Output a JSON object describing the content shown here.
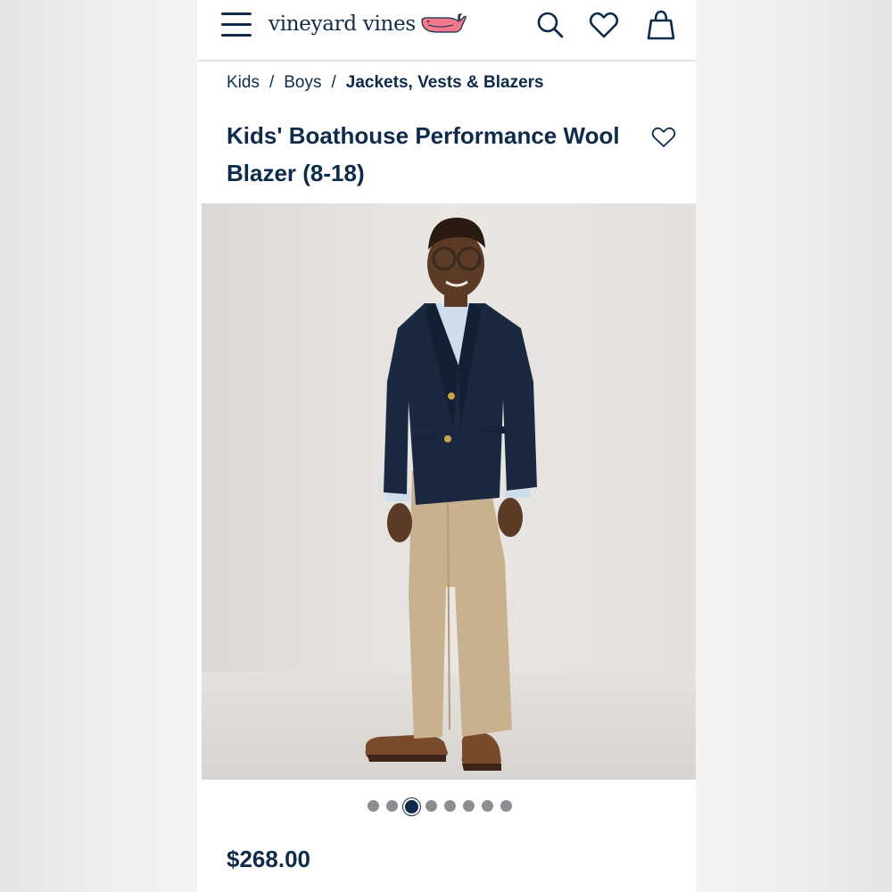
{
  "header": {
    "brand": "vineyard vines",
    "icons": [
      "hamburger-menu-icon",
      "whale-logo-icon",
      "search-icon",
      "heart-icon",
      "shopping-bag-icon"
    ]
  },
  "breadcrumb": {
    "items": [
      "Kids",
      "Boys",
      "Jackets, Vests & Blazers"
    ],
    "separator": "/"
  },
  "product": {
    "title": "Kids' Boathouse Performance Wool Blazer (8-18)",
    "price": "$268.00",
    "image_alt": "Boy wearing navy blazer, light blue shirt, khaki pants and brown boat shoes",
    "carousel": {
      "total": 8,
      "active_index": 2
    }
  },
  "colors": {
    "navy": "#0f2b4a",
    "whale_pink": "#f07a8c",
    "dot_inactive": "#8b8d90"
  }
}
